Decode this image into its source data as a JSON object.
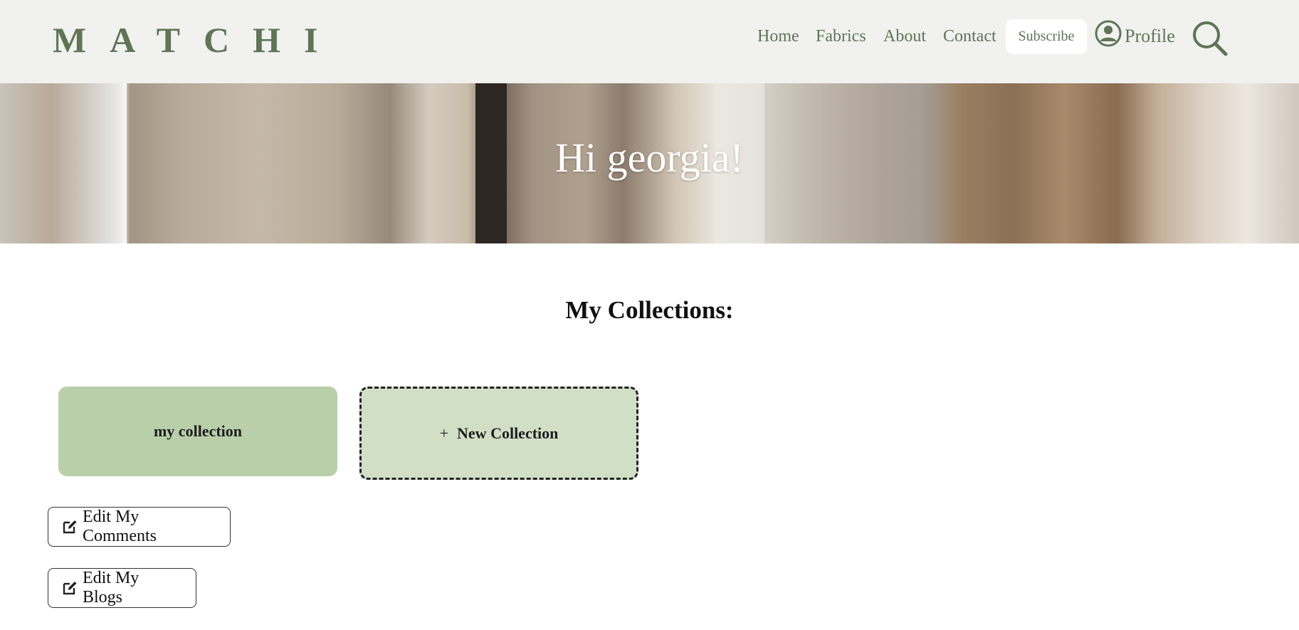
{
  "header": {
    "logo": "MATCHI",
    "nav": [
      {
        "label": "Home"
      },
      {
        "label": "Fabrics"
      },
      {
        "label": "About"
      },
      {
        "label": "Contact"
      }
    ],
    "subscribe_label": "Subscribe",
    "profile_label": "Profile",
    "profile_icon": "user-circle-icon",
    "search_icon": "search-icon",
    "accent_color": "#5e7556"
  },
  "hero": {
    "greeting": "Hi georgia!"
  },
  "collections": {
    "title": "My Collections:",
    "items": [
      {
        "label": "my collection"
      }
    ],
    "new_label": "New Collection",
    "new_prefix": "+"
  },
  "actions": {
    "edit_comments": "Edit My Comments",
    "edit_blogs": "Edit My Blogs",
    "edit_icon": "edit-icon"
  }
}
